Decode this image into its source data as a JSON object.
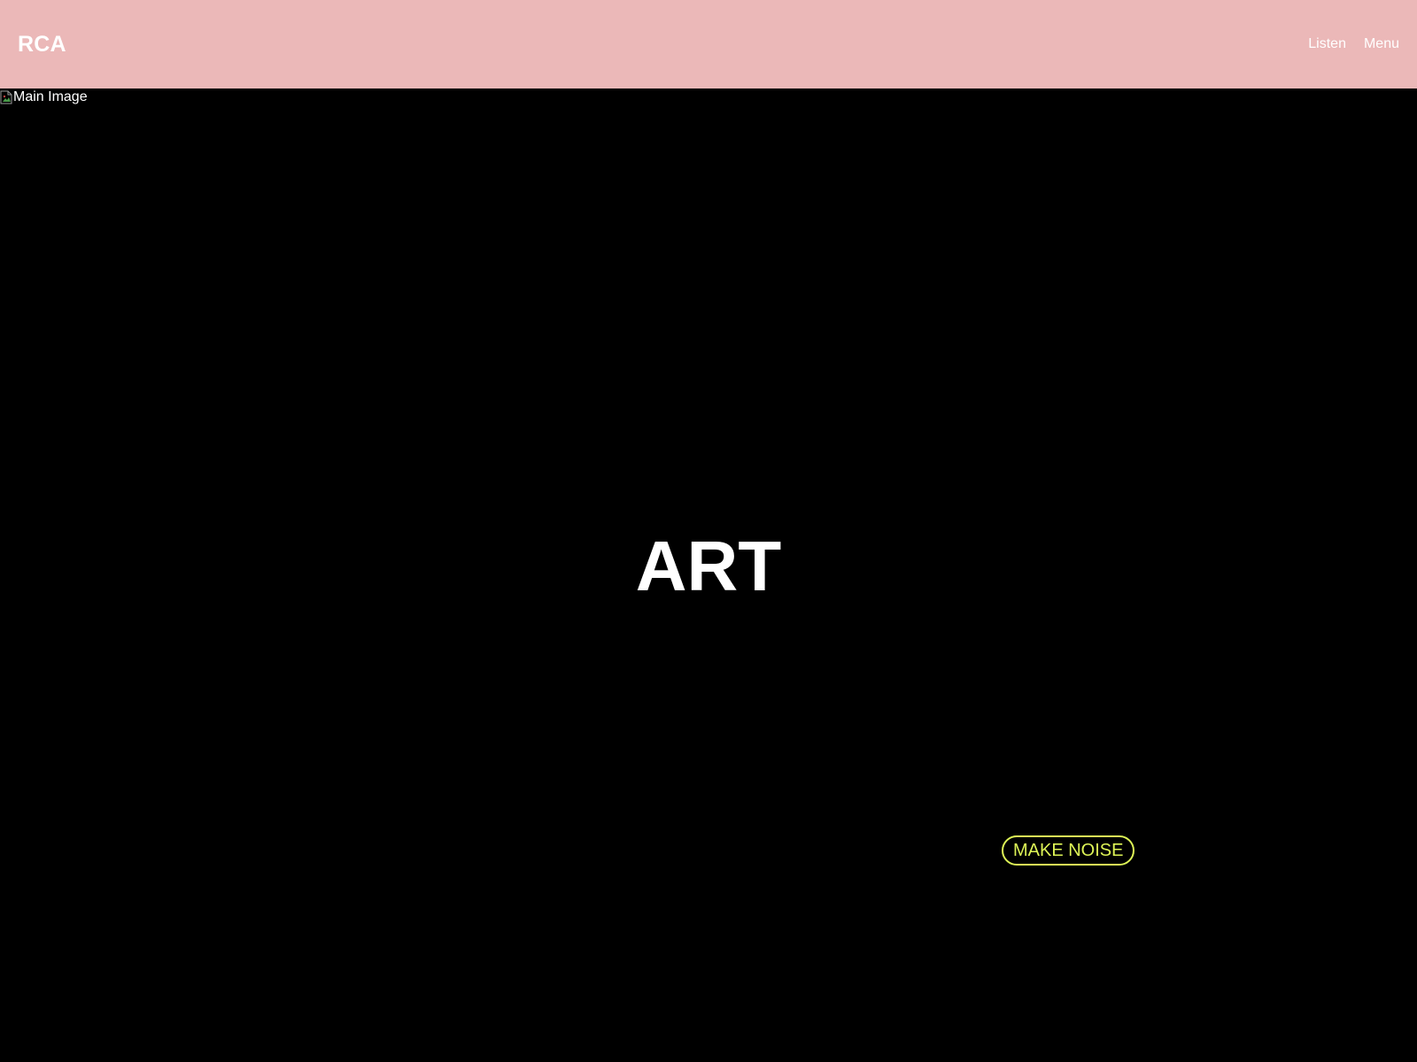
{
  "header": {
    "logo": "RCA",
    "nav": [
      {
        "label": "Listen"
      },
      {
        "label": "Menu"
      }
    ]
  },
  "hero": {
    "image_alt": "Main Image",
    "headline": "ART",
    "cta_label": "MAKE NOISE"
  },
  "colors": {
    "header_bg": "#ebb8b8",
    "page_bg": "#000000",
    "text": "#ffffff",
    "accent": "#ddf356"
  },
  "icons": {
    "broken_image": "broken-image-icon"
  }
}
